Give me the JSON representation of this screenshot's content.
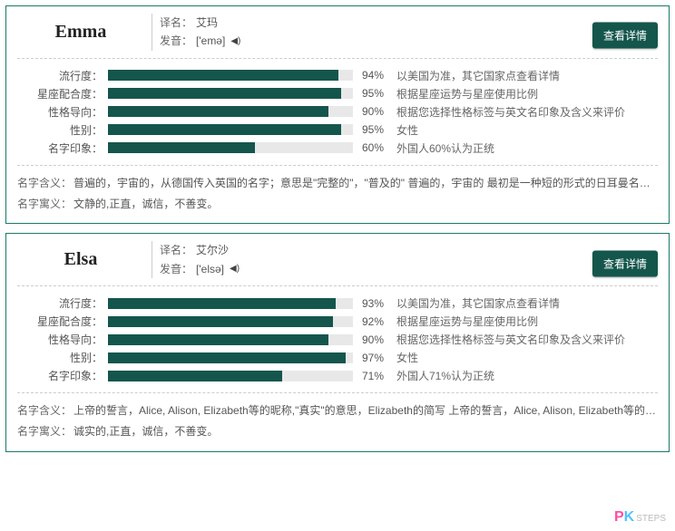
{
  "entries": [
    {
      "name": "Emma",
      "translit_label": "译名：",
      "translit": "艾玛",
      "pron_label": "发音：",
      "pron": "['emə]",
      "details_btn": "查看详情",
      "bars": [
        {
          "label": "流行度：",
          "pct": 94,
          "desc": "以美国为准，其它国家点查看详情"
        },
        {
          "label": "星座配合度：",
          "pct": 95,
          "desc": "根据星座运势与星座使用比例"
        },
        {
          "label": "性格导向：",
          "pct": 90,
          "desc": "根据您选择性格标签与英文名印象及含义来评价"
        },
        {
          "label": "性别：",
          "pct": 95,
          "desc": "女性"
        },
        {
          "label": "名字印象：",
          "pct": 60,
          "desc": "外国人60%认为正统"
        }
      ],
      "meaning_label": "名字含义：",
      "meaning": "普遍的，宇宙的，从德国传入英国的名字；意思是\"完整的\"，\"普及的\" 普遍的，宇宙的 最初是一种短的形式的日耳曼名字，从元…",
      "moral_label": "名字寓义：",
      "moral": "文静的,正直，诚信，不善变。"
    },
    {
      "name": "Elsa",
      "translit_label": "译名：",
      "translit": "艾尔沙",
      "pron_label": "发音：",
      "pron": "['elsə]",
      "details_btn": "查看详情",
      "bars": [
        {
          "label": "流行度：",
          "pct": 93,
          "desc": "以美国为准，其它国家点查看详情"
        },
        {
          "label": "星座配合度：",
          "pct": 92,
          "desc": "根据星座运势与星座使用比例"
        },
        {
          "label": "性格导向：",
          "pct": 90,
          "desc": "根据您选择性格标签与英文名印象及含义来评价"
        },
        {
          "label": "性别：",
          "pct": 97,
          "desc": "女性"
        },
        {
          "label": "名字印象：",
          "pct": 71,
          "desc": "外国人71%认为正统"
        }
      ],
      "meaning_label": "名字含义：",
      "meaning": "上帝的誓言，Alice, Alison, Elizabeth等的昵称,\"真实\"的意思，Elizabeth的简写 上帝的誓言，Alice, Alison, Elizabeth等的昵称 ELIS…",
      "moral_label": "名字寓义：",
      "moral": "诚实的,正直，诚信，不善变。"
    }
  ],
  "watermark": {
    "p": "P",
    "k": "K",
    "suffix": "STEPS"
  }
}
